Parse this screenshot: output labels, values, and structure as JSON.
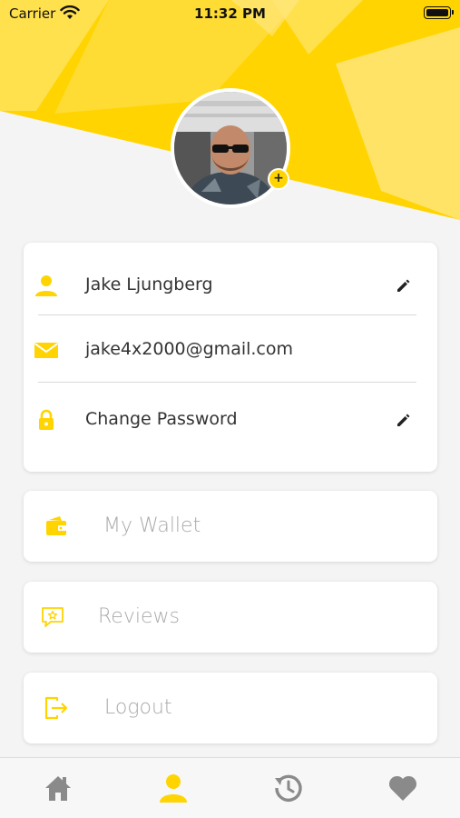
{
  "status_bar": {
    "carrier": "Carrier",
    "time": "11:32 PM"
  },
  "profile": {
    "name": "Jake Ljungberg",
    "email": "jake4x2000@gmail.com",
    "change_password": "Change Password",
    "avatar_add": "+"
  },
  "menu": {
    "wallet": "My Wallet",
    "reviews": "Reviews",
    "logout": "Logout"
  },
  "colors": {
    "accent": "#ffd400",
    "accent_light": "#ffe366",
    "background": "#f4f4f4"
  },
  "tabs": [
    "home-icon",
    "profile-icon",
    "history-icon",
    "heart-icon"
  ],
  "active_tab": "profile-icon"
}
